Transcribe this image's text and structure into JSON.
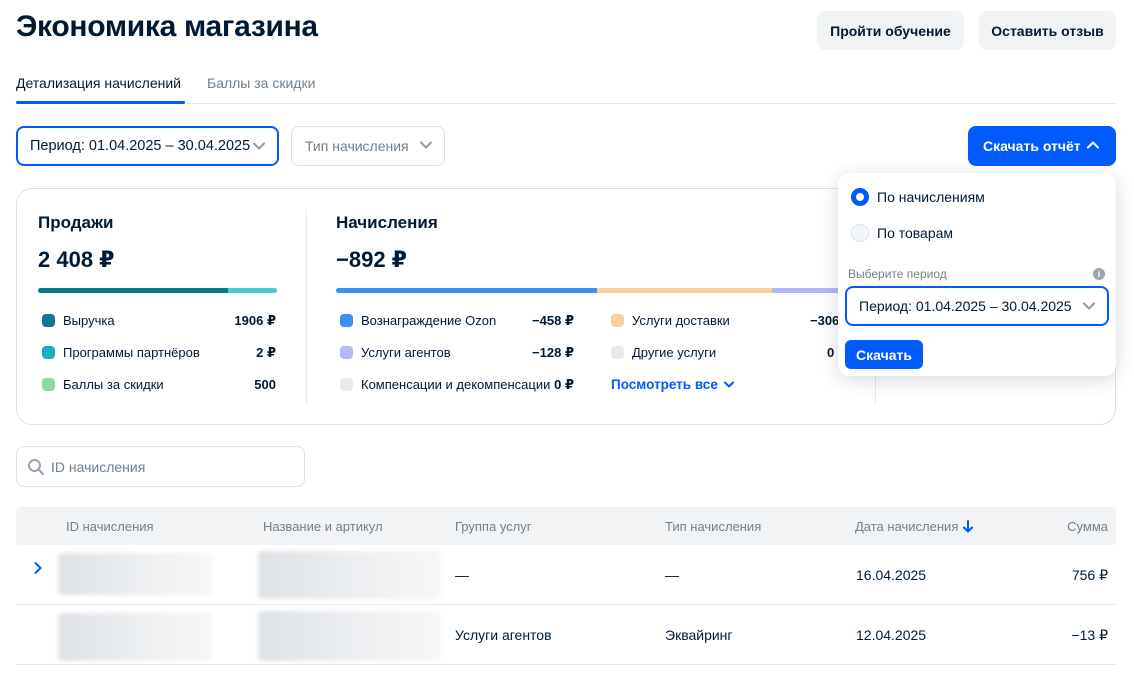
{
  "page_title": "Экономика магазина",
  "header_buttons": {
    "learn": "Пройти обучение",
    "review": "Оставить отзыв"
  },
  "tabs": [
    {
      "label": "Детализация начислений",
      "active": true
    },
    {
      "label": "Баллы за скидки",
      "active": false
    }
  ],
  "filters": {
    "period": "Период: 01.04.2025 – 30.04.2025",
    "accrual_type": "Тип начисления"
  },
  "download_report": "Скачать отчёт",
  "sales": {
    "title": "Продажи",
    "total": "2 408 ₽",
    "items": [
      {
        "label": "Выручка",
        "value": "1906 ₽",
        "color": "#0a7a8a"
      },
      {
        "label": "Программы партнёров",
        "value": "2 ₽",
        "color": "#1ab0c0"
      },
      {
        "label": "Баллы за скидки",
        "value": "500",
        "color": "#8fd9a8"
      }
    ]
  },
  "accruals": {
    "title": "Начисления",
    "total": "−892 ₽",
    "items": [
      {
        "label": "Вознаграждение Ozon",
        "value": "−458 ₽",
        "color": "#3b8ff0"
      },
      {
        "label": "Услуги агентов",
        "value": "−128 ₽",
        "color": "#b1b9f6"
      },
      {
        "label": "Компенсации и декомпенсации",
        "value": "0 ₽",
        "color": "#e6e9ee"
      },
      {
        "label": "Услуги доставки",
        "value": "−306",
        "color": "#f5d39a"
      },
      {
        "label": "Другие услуги",
        "value": "0",
        "color": "#e6e9ee"
      }
    ],
    "see_all": "Посмотреть все"
  },
  "search": {
    "placeholder": "ID начисления"
  },
  "table": {
    "columns": [
      "ID начисления",
      "Название и артикул",
      "Группа услуг",
      "Тип начисления",
      "Дата начисления",
      "Сумма"
    ],
    "rows": [
      {
        "group": "—",
        "type": "—",
        "date": "16.04.2025",
        "sum": "756 ₽"
      },
      {
        "group": "Услуги агентов",
        "type": "Эквайринг",
        "date": "12.04.2025",
        "sum": "−13 ₽"
      }
    ]
  },
  "report_dropdown": {
    "options": [
      {
        "label": "По начислениям",
        "selected": true
      },
      {
        "label": "По товарам",
        "selected": false
      }
    ],
    "period_label": "Выберите период",
    "period_value": "Период: 01.04.2025 – 30.04.2025",
    "download": "Скачать"
  },
  "colors": {
    "accent": "#005bff",
    "text": "#001a34",
    "muted": "#707f8d"
  }
}
